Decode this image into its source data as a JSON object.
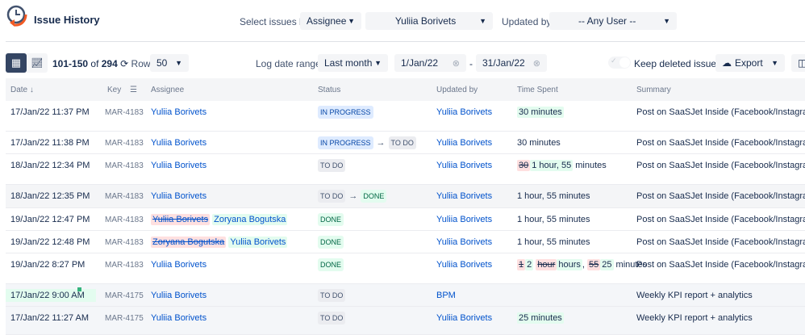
{
  "app": {
    "title": "Issue History"
  },
  "filters": {
    "select_label": "Select issues by:",
    "select_by": "Assignee",
    "user": "Yuliia Borivets",
    "updated_label": "Updated by:",
    "updated_by": "-- Any User --"
  },
  "toolbar": {
    "range": "101-150",
    "of": "of",
    "total": "294",
    "rows_label": "Rows:",
    "rows": "50",
    "log_label": "Log date range:",
    "log_range": "Last month",
    "date_from": "1/Jan/22",
    "date_sep": "-",
    "date_to": "31/Jan/22",
    "keep_deleted": "Keep deleted issues",
    "keep_deleted_on": false,
    "export": "Export"
  },
  "colors": {
    "accent": "#0052cc",
    "header_bg": "#f4f5f7"
  },
  "columns": [
    "Date ↓",
    "Key",
    "Assignee",
    "Status",
    "Updated by",
    "Time Spent",
    "Summary"
  ],
  "rows": [
    {
      "date": "17/Jan/22 11:37 PM",
      "key": "MAR-4183",
      "assignee": [
        {
          "t": "Yuliia Borivets"
        }
      ],
      "status": [
        {
          "t": "IN PROGRESS",
          "c": "IN"
        }
      ],
      "updated_by": "Yuliia Borivets",
      "time": [
        {
          "t": "30 minutes",
          "k": "add"
        }
      ],
      "summary": "Post on SaaSJet Inside (Facebook/Instagram)"
    },
    {
      "date": "17/Jan/22 11:38 PM",
      "key": "MAR-4183",
      "assignee": [
        {
          "t": "Yuliia Borivets"
        }
      ],
      "status": [
        {
          "t": "IN PROGRESS",
          "c": "IN"
        },
        {
          "t": "TO DO",
          "c": "TO"
        }
      ],
      "updated_by": "Yuliia Borivets",
      "time": [
        {
          "t": "30 minutes"
        }
      ],
      "summary": "Post on SaaSJet Inside (Facebook/Instagram)"
    },
    {
      "date": "18/Jan/22 12:34 PM",
      "key": "MAR-4183",
      "assignee": [
        {
          "t": "Yuliia Borivets"
        }
      ],
      "status": [
        {
          "t": "TO DO",
          "c": "TO"
        }
      ],
      "updated_by": "Yuliia Borivets",
      "time": [
        {
          "t": "30",
          "k": "del"
        },
        {
          "t": "1 hour, 55",
          "k": "add"
        },
        {
          "t": " minutes"
        }
      ],
      "summary": "Post on SaaSJet Inside (Facebook/Instagram)"
    },
    {
      "date": "18/Jan/22 12:35 PM",
      "key": "MAR-4183",
      "assignee": [
        {
          "t": "Yuliia Borivets"
        }
      ],
      "status": [
        {
          "t": "TO DO",
          "c": "TO"
        },
        {
          "t": "DONE",
          "c": "DONE"
        }
      ],
      "updated_by": "Yuliia Borivets",
      "time": [
        {
          "t": "1 hour, 55 minutes"
        }
      ],
      "summary": "Post on SaaSJet Inside (Facebook/Instagram)"
    },
    {
      "date": "19/Jan/22 12:47 PM",
      "key": "MAR-4183",
      "assignee": [
        {
          "t": "Yuliia Borivets",
          "k": "del"
        },
        {
          "t": " "
        },
        {
          "t": "Zoryana Bogutska",
          "k": "add"
        }
      ],
      "status": [
        {
          "t": "DONE",
          "c": "DONE"
        }
      ],
      "updated_by": "Yuliia Borivets",
      "time": [
        {
          "t": "1 hour, 55 minutes"
        }
      ],
      "summary": "Post on SaaSJet Inside (Facebook/Instagram)"
    },
    {
      "date": "19/Jan/22 12:48 PM",
      "key": "MAR-4183",
      "assignee": [
        {
          "t": "Zoryana Bogutska",
          "k": "del"
        },
        {
          "t": " "
        },
        {
          "t": "Yuliia Borivets",
          "k": "add"
        }
      ],
      "status": [
        {
          "t": "DONE",
          "c": "DONE"
        }
      ],
      "updated_by": "Yuliia Borivets",
      "time": [
        {
          "t": "1 hour, 55 minutes"
        }
      ],
      "summary": "Post on SaaSJet Inside (Facebook/Instagram)"
    },
    {
      "date": "19/Jan/22 8:27 PM",
      "key": "MAR-4183",
      "assignee": [
        {
          "t": "Yuliia Borivets"
        }
      ],
      "status": [
        {
          "t": "DONE",
          "c": "DONE"
        }
      ],
      "updated_by": "Yuliia Borivets",
      "time": [
        {
          "t": "1",
          "k": "del"
        },
        {
          "t": "2",
          "k": "add"
        },
        {
          "t": " "
        },
        {
          "t": "hour",
          "k": "del"
        },
        {
          "t": "hours",
          "k": "add"
        },
        {
          "t": ", "
        },
        {
          "t": "55",
          "k": "del"
        },
        {
          "t": "25",
          "k": "add"
        },
        {
          "t": " minutes"
        }
      ],
      "summary": "Post on SaaSJet Inside (Facebook/Instagram)"
    },
    {
      "date": "17/Jan/22 9:00 AM",
      "date_new": true,
      "key": "MAR-4175",
      "assignee": [
        {
          "t": "Yuliia Borivets"
        }
      ],
      "status": [
        {
          "t": "TO DO",
          "c": "TO"
        }
      ],
      "updated_by": "BPM",
      "time": [],
      "summary": "Weekly KPI report + analytics"
    },
    {
      "date": "17/Jan/22 11:27 AM",
      "key": "MAR-4175",
      "assignee": [
        {
          "t": "Yuliia Borivets"
        }
      ],
      "status": [
        {
          "t": "TO DO",
          "c": "TO"
        }
      ],
      "updated_by": "Yuliia Borivets",
      "time": [
        {
          "t": "25 minutes",
          "k": "add"
        }
      ],
      "summary": "Weekly KPI report + analytics"
    }
  ]
}
